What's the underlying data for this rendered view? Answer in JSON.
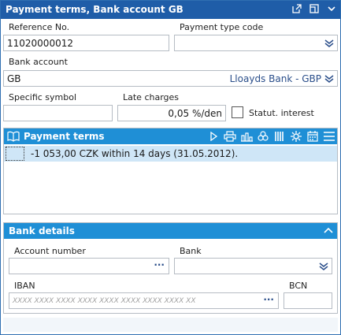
{
  "window": {
    "title": "Payment terms, Bank account GB"
  },
  "form": {
    "reference_label": "Reference No.",
    "reference_value": "11020000012",
    "payment_type_label": "Payment type code",
    "payment_type_value": "",
    "bank_account_label": "Bank account",
    "bank_account_value": "GB",
    "bank_account_name": "Lloayds Bank - GBP",
    "specific_symbol_label": "Specific symbol",
    "specific_symbol_value": "",
    "late_charges_label": "Late charges",
    "late_charges_value": "0,05 %/den",
    "statut_interest_label": "Statut. interest"
  },
  "payment_terms": {
    "title": "Payment terms",
    "rows": [
      {
        "text": "-1 053,00 CZK within 14 days (31.05.2012)."
      }
    ]
  },
  "bank_details": {
    "title": "Bank details",
    "account_number_label": "Account number",
    "account_number_value": "",
    "bank_label": "Bank",
    "bank_value": "",
    "iban_label": "IBAN",
    "iban_placeholder": "XXXX XXXX XXXX XXXX XXXX XXXX XXXX XXXX XX",
    "bcn_label": "BCN",
    "bcn_value": ""
  },
  "colors": {
    "titlebar": "#1f5da8",
    "section": "#1f8fd6",
    "row_highlight": "#cfe6f7"
  }
}
